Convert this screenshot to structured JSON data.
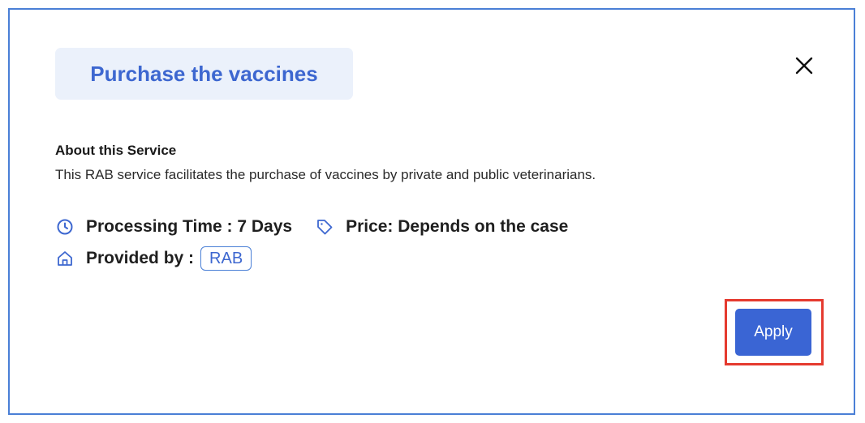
{
  "modal": {
    "title": "Purchase the vaccines",
    "close_icon": "close-icon",
    "about": {
      "heading": "About this Service",
      "description": "This RAB service facilitates the purchase of vaccines by private and public veterinarians."
    },
    "meta": {
      "processing_time_icon": "clock-icon",
      "processing_time": "Processing Time : 7 Days",
      "price_icon": "tag-icon",
      "price": "Price: Depends on the case",
      "provider_icon": "home-icon",
      "provided_by_label": "Provided by :",
      "provider": "RAB"
    },
    "apply_label": "Apply"
  },
  "colors": {
    "accent": "#3a65d4",
    "title_bg": "#ebf1fb",
    "frame_border": "#4a7fd6",
    "highlight": "#e53a2f"
  }
}
